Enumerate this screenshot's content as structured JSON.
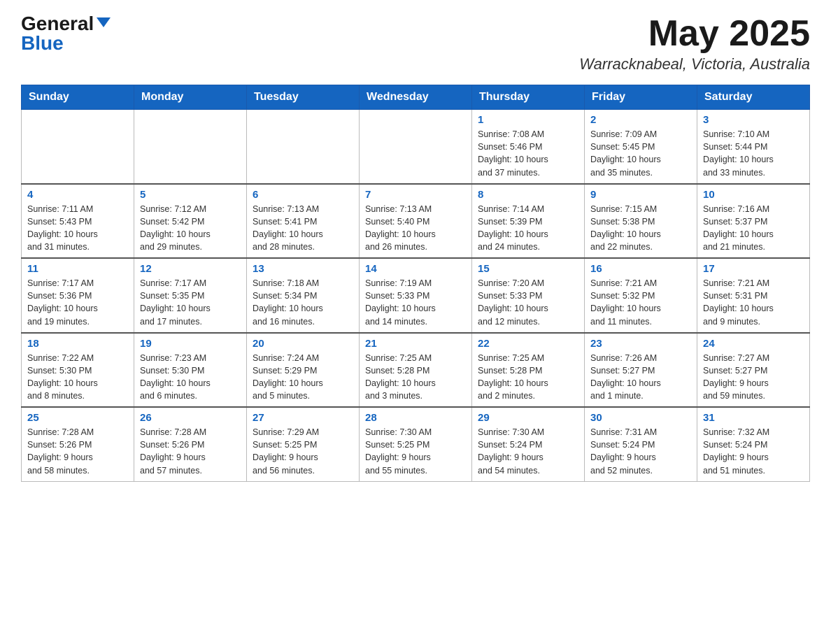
{
  "header": {
    "logo_general": "General",
    "logo_blue": "Blue",
    "month": "May 2025",
    "location": "Warracknabeal, Victoria, Australia"
  },
  "weekdays": [
    "Sunday",
    "Monday",
    "Tuesday",
    "Wednesday",
    "Thursday",
    "Friday",
    "Saturday"
  ],
  "weeks": [
    [
      {
        "day": "",
        "info": ""
      },
      {
        "day": "",
        "info": ""
      },
      {
        "day": "",
        "info": ""
      },
      {
        "day": "",
        "info": ""
      },
      {
        "day": "1",
        "info": "Sunrise: 7:08 AM\nSunset: 5:46 PM\nDaylight: 10 hours\nand 37 minutes."
      },
      {
        "day": "2",
        "info": "Sunrise: 7:09 AM\nSunset: 5:45 PM\nDaylight: 10 hours\nand 35 minutes."
      },
      {
        "day": "3",
        "info": "Sunrise: 7:10 AM\nSunset: 5:44 PM\nDaylight: 10 hours\nand 33 minutes."
      }
    ],
    [
      {
        "day": "4",
        "info": "Sunrise: 7:11 AM\nSunset: 5:43 PM\nDaylight: 10 hours\nand 31 minutes."
      },
      {
        "day": "5",
        "info": "Sunrise: 7:12 AM\nSunset: 5:42 PM\nDaylight: 10 hours\nand 29 minutes."
      },
      {
        "day": "6",
        "info": "Sunrise: 7:13 AM\nSunset: 5:41 PM\nDaylight: 10 hours\nand 28 minutes."
      },
      {
        "day": "7",
        "info": "Sunrise: 7:13 AM\nSunset: 5:40 PM\nDaylight: 10 hours\nand 26 minutes."
      },
      {
        "day": "8",
        "info": "Sunrise: 7:14 AM\nSunset: 5:39 PM\nDaylight: 10 hours\nand 24 minutes."
      },
      {
        "day": "9",
        "info": "Sunrise: 7:15 AM\nSunset: 5:38 PM\nDaylight: 10 hours\nand 22 minutes."
      },
      {
        "day": "10",
        "info": "Sunrise: 7:16 AM\nSunset: 5:37 PM\nDaylight: 10 hours\nand 21 minutes."
      }
    ],
    [
      {
        "day": "11",
        "info": "Sunrise: 7:17 AM\nSunset: 5:36 PM\nDaylight: 10 hours\nand 19 minutes."
      },
      {
        "day": "12",
        "info": "Sunrise: 7:17 AM\nSunset: 5:35 PM\nDaylight: 10 hours\nand 17 minutes."
      },
      {
        "day": "13",
        "info": "Sunrise: 7:18 AM\nSunset: 5:34 PM\nDaylight: 10 hours\nand 16 minutes."
      },
      {
        "day": "14",
        "info": "Sunrise: 7:19 AM\nSunset: 5:33 PM\nDaylight: 10 hours\nand 14 minutes."
      },
      {
        "day": "15",
        "info": "Sunrise: 7:20 AM\nSunset: 5:33 PM\nDaylight: 10 hours\nand 12 minutes."
      },
      {
        "day": "16",
        "info": "Sunrise: 7:21 AM\nSunset: 5:32 PM\nDaylight: 10 hours\nand 11 minutes."
      },
      {
        "day": "17",
        "info": "Sunrise: 7:21 AM\nSunset: 5:31 PM\nDaylight: 10 hours\nand 9 minutes."
      }
    ],
    [
      {
        "day": "18",
        "info": "Sunrise: 7:22 AM\nSunset: 5:30 PM\nDaylight: 10 hours\nand 8 minutes."
      },
      {
        "day": "19",
        "info": "Sunrise: 7:23 AM\nSunset: 5:30 PM\nDaylight: 10 hours\nand 6 minutes."
      },
      {
        "day": "20",
        "info": "Sunrise: 7:24 AM\nSunset: 5:29 PM\nDaylight: 10 hours\nand 5 minutes."
      },
      {
        "day": "21",
        "info": "Sunrise: 7:25 AM\nSunset: 5:28 PM\nDaylight: 10 hours\nand 3 minutes."
      },
      {
        "day": "22",
        "info": "Sunrise: 7:25 AM\nSunset: 5:28 PM\nDaylight: 10 hours\nand 2 minutes."
      },
      {
        "day": "23",
        "info": "Sunrise: 7:26 AM\nSunset: 5:27 PM\nDaylight: 10 hours\nand 1 minute."
      },
      {
        "day": "24",
        "info": "Sunrise: 7:27 AM\nSunset: 5:27 PM\nDaylight: 9 hours\nand 59 minutes."
      }
    ],
    [
      {
        "day": "25",
        "info": "Sunrise: 7:28 AM\nSunset: 5:26 PM\nDaylight: 9 hours\nand 58 minutes."
      },
      {
        "day": "26",
        "info": "Sunrise: 7:28 AM\nSunset: 5:26 PM\nDaylight: 9 hours\nand 57 minutes."
      },
      {
        "day": "27",
        "info": "Sunrise: 7:29 AM\nSunset: 5:25 PM\nDaylight: 9 hours\nand 56 minutes."
      },
      {
        "day": "28",
        "info": "Sunrise: 7:30 AM\nSunset: 5:25 PM\nDaylight: 9 hours\nand 55 minutes."
      },
      {
        "day": "29",
        "info": "Sunrise: 7:30 AM\nSunset: 5:24 PM\nDaylight: 9 hours\nand 54 minutes."
      },
      {
        "day": "30",
        "info": "Sunrise: 7:31 AM\nSunset: 5:24 PM\nDaylight: 9 hours\nand 52 minutes."
      },
      {
        "day": "31",
        "info": "Sunrise: 7:32 AM\nSunset: 5:24 PM\nDaylight: 9 hours\nand 51 minutes."
      }
    ]
  ]
}
